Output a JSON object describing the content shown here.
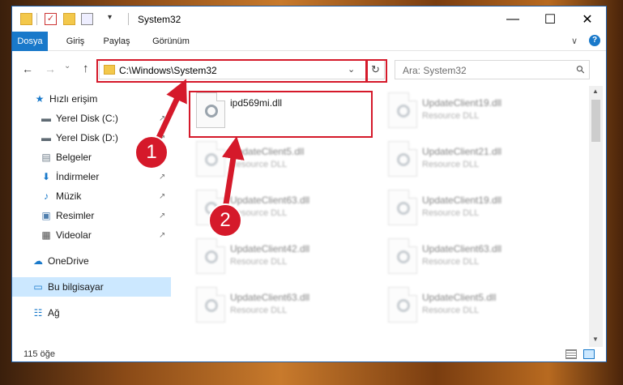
{
  "titlebar": {
    "title": "System32",
    "minimize": "—",
    "maximize": "☐",
    "close": "✕"
  },
  "ribbon": {
    "tabs": [
      "Dosya",
      "Giriş",
      "Paylaş",
      "Görünüm"
    ],
    "collapse_glyph": "∨",
    "help_glyph": "?"
  },
  "navbar": {
    "back": "←",
    "forward": "→",
    "recent": "⌄",
    "up": "↑",
    "address": "C:\\Windows\\System32",
    "refresh": "↻",
    "dropdown": "⌄",
    "search_placeholder": "Ara: System32",
    "search_icon": "⚲"
  },
  "sidebar": {
    "items": [
      {
        "label": "Hızlı erişim",
        "icon": "star-icon",
        "glyph": "★",
        "color": "#1979ca",
        "pinned": false
      },
      {
        "label": "Yerel Disk (C:)",
        "icon": "drive-icon",
        "glyph": "▬",
        "color": "#5f6a73",
        "pinned": true
      },
      {
        "label": "Yerel Disk (D:)",
        "icon": "drive-icon",
        "glyph": "▬",
        "color": "#5f6a73",
        "pinned": true
      },
      {
        "label": "Belgeler",
        "icon": "documents-icon",
        "glyph": "▤",
        "color": "#6d7b88",
        "pinned": true
      },
      {
        "label": "İndirmeler",
        "icon": "download-icon",
        "glyph": "⬇",
        "color": "#1979ca",
        "pinned": true
      },
      {
        "label": "Müzik",
        "icon": "music-icon",
        "glyph": "♪",
        "color": "#1979ca",
        "pinned": true
      },
      {
        "label": "Resimler",
        "icon": "pictures-icon",
        "glyph": "▣",
        "color": "#4f7fae",
        "pinned": true
      },
      {
        "label": "Videolar",
        "icon": "videos-icon",
        "glyph": "▦",
        "color": "#4a4a4a",
        "pinned": true
      },
      {
        "label": "OneDrive",
        "icon": "onedrive-icon",
        "glyph": "☁",
        "color": "#1979ca",
        "pinned": false
      },
      {
        "label": "Bu bilgisayar",
        "icon": "computer-icon",
        "glyph": "▭",
        "color": "#1979ca",
        "pinned": false
      },
      {
        "label": "Ağ",
        "icon": "network-icon",
        "glyph": "☷",
        "color": "#1979ca",
        "pinned": false
      }
    ],
    "pin_glyph": "↗"
  },
  "files": [
    {
      "name": "ipd569mi.dll",
      "type": "",
      "highlight": true
    },
    {
      "name": "UpdateClient19.dll",
      "type": "Resource DLL"
    },
    {
      "name": "UpdateClient5.dll",
      "type": "Resource DLL"
    },
    {
      "name": "UpdateClient21.dll",
      "type": "Resource DLL"
    },
    {
      "name": "UpdateClient63.dll",
      "type": "Resource DLL"
    },
    {
      "name": "UpdateClient19.dll",
      "type": "Resource DLL"
    },
    {
      "name": "UpdateClient42.dll",
      "type": "Resource DLL"
    },
    {
      "name": "UpdateClient63.dll",
      "type": "Resource DLL"
    },
    {
      "name": "UpdateClient63.dll",
      "type": "Resource DLL"
    },
    {
      "name": "UpdateClient5.dll",
      "type": "Resource DLL"
    }
  ],
  "status": {
    "count": "115 öğe"
  },
  "annotations": {
    "badge1": "1",
    "badge2": "2",
    "highlight_color": "#d5192a"
  }
}
